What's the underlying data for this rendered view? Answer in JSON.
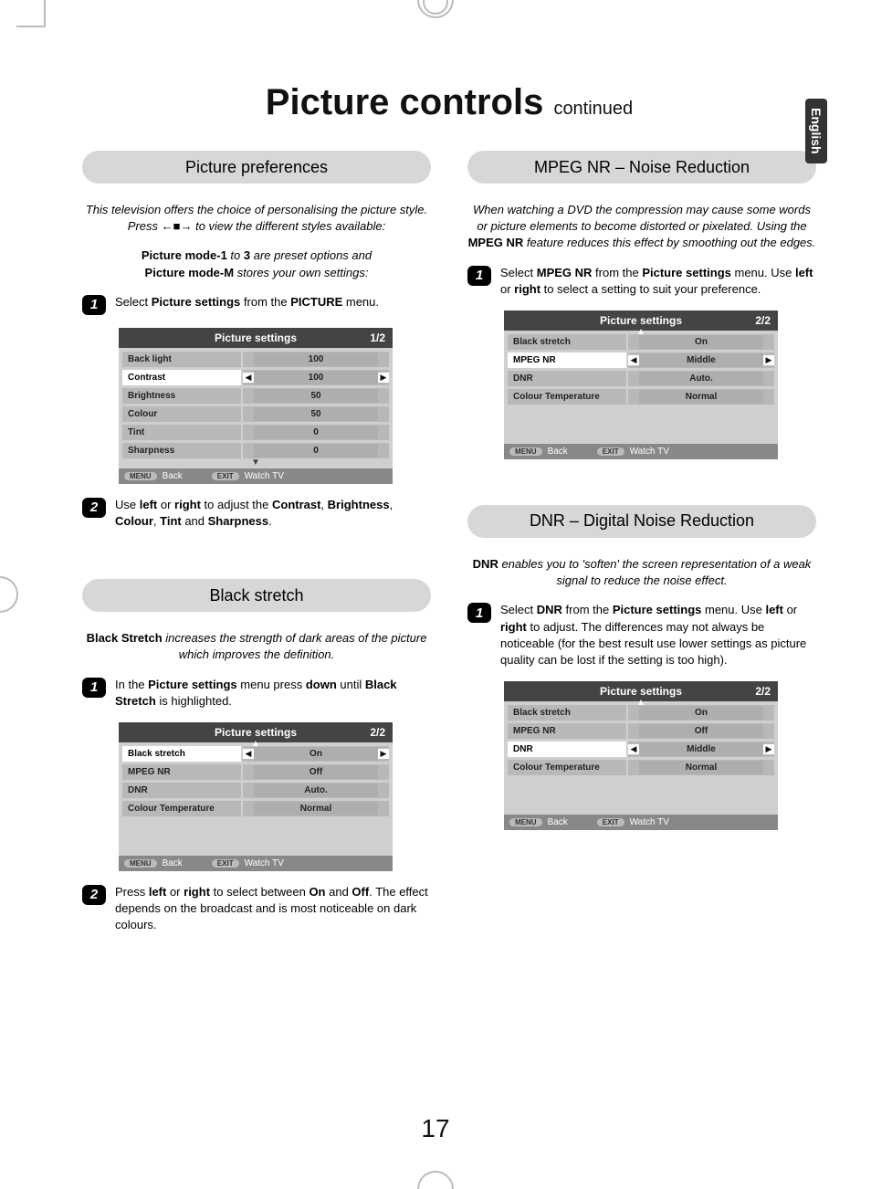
{
  "sideTab": "English",
  "pageTitle": {
    "main": "Picture controls",
    "sub": "continued"
  },
  "pageNumber": "17",
  "picturePref": {
    "heading": "Picture preferences",
    "intro1": "This television offers the choice of personalising the picture style. Press ←■→ to view the different styles available:",
    "intro2a": "Picture mode-1",
    "intro2b": " to ",
    "intro2c": "3",
    "intro2d": " are preset options and ",
    "intro2e": "Picture mode-M",
    "intro2f": " stores your own settings:",
    "step1a": "Select ",
    "step1b": "Picture settings",
    "step1c": " from the ",
    "step1d": "PICTURE",
    "step1e": " menu.",
    "step2a": "Use ",
    "step2b": "left",
    "step2c": " or ",
    "step2d": "right",
    "step2e": " to adjust the ",
    "step2f": "Contrast",
    "step2g": ", ",
    "step2h": "Brightness",
    "step2i": ", ",
    "step2j": "Colour",
    "step2k": ", ",
    "step2l": "Tint",
    "step2m": " and ",
    "step2n": "Sharpness",
    "step2o": "."
  },
  "blackStretch": {
    "heading": "Black stretch",
    "intro1a": "Black Stretch",
    "intro1b": " increases the strength of dark areas of the picture which improves the definition.",
    "step1a": "In the ",
    "step1b": "Picture settings",
    "step1c": " menu press ",
    "step1d": "down",
    "step1e": " until ",
    "step1f": "Black Stretch",
    "step1g": " is highlighted.",
    "step2a": "Press ",
    "step2b": "left",
    "step2c": " or ",
    "step2d": "right",
    "step2e": " to select between ",
    "step2f": "On",
    "step2g": " and ",
    "step2h": "Off",
    "step2i": ". The effect depends on the broadcast and is most noticeable on dark colours."
  },
  "mpegNR": {
    "heading": "MPEG NR – Noise Reduction",
    "intro1a": "When watching a DVD the compression may cause some words or picture elements to become distorted or pixelated. Using the ",
    "intro1b": "MPEG NR",
    "intro1c": " feature reduces this effect by smoothing out the edges.",
    "step1a": "Select ",
    "step1b": "MPEG NR",
    "step1c": " from the ",
    "step1d": "Picture settings",
    "step1e": " menu. Use ",
    "step1f": "left",
    "step1g": " or ",
    "step1h": "right",
    "step1i": " to select a setting to suit your preference."
  },
  "dnr": {
    "heading": "DNR – Digital Noise Reduction",
    "intro1a": "DNR",
    "intro1b": " enables you to 'soften' the screen representation of a weak signal to reduce the noise effect.",
    "step1a": "Select ",
    "step1b": "DNR",
    "step1c": " from the ",
    "step1d": "Picture settings",
    "step1e": " menu. Use ",
    "step1f": "left",
    "step1g": " or ",
    "step1h": "right",
    "step1i": " to adjust. The differences may not always be noticeable (for the best result use lower settings as picture quality can be lost if the setting is too high)."
  },
  "osdCommon": {
    "title": "Picture settings",
    "menuBtn": "MENU",
    "back": "Back",
    "exitBtn": "EXIT",
    "watchTv": "Watch TV"
  },
  "osd1": {
    "page": "1/2",
    "rows": [
      {
        "label": "Back light",
        "value": "100"
      },
      {
        "label": "Contrast",
        "value": "100",
        "selected": true
      },
      {
        "label": "Brightness",
        "value": "50"
      },
      {
        "label": "Colour",
        "value": "50"
      },
      {
        "label": "Tint",
        "value": "0"
      },
      {
        "label": "Sharpness",
        "value": "0"
      }
    ]
  },
  "osd2": {
    "page": "2/2",
    "rows": [
      {
        "label": "Black stretch",
        "value": "On",
        "selected": true
      },
      {
        "label": "MPEG NR",
        "value": "Off"
      },
      {
        "label": "DNR",
        "value": "Auto."
      },
      {
        "label": "Colour Temperature",
        "value": "Normal"
      }
    ]
  },
  "osd3": {
    "page": "2/2",
    "rows": [
      {
        "label": "Black stretch",
        "value": "On"
      },
      {
        "label": "MPEG NR",
        "value": "Middle",
        "selected": true
      },
      {
        "label": "DNR",
        "value": "Auto."
      },
      {
        "label": "Colour Temperature",
        "value": "Normal"
      }
    ]
  },
  "osd4": {
    "page": "2/2",
    "rows": [
      {
        "label": "Black stretch",
        "value": "On"
      },
      {
        "label": "MPEG NR",
        "value": "Off"
      },
      {
        "label": "DNR",
        "value": "Middle",
        "selected": true
      },
      {
        "label": "Colour Temperature",
        "value": "Normal"
      }
    ]
  }
}
